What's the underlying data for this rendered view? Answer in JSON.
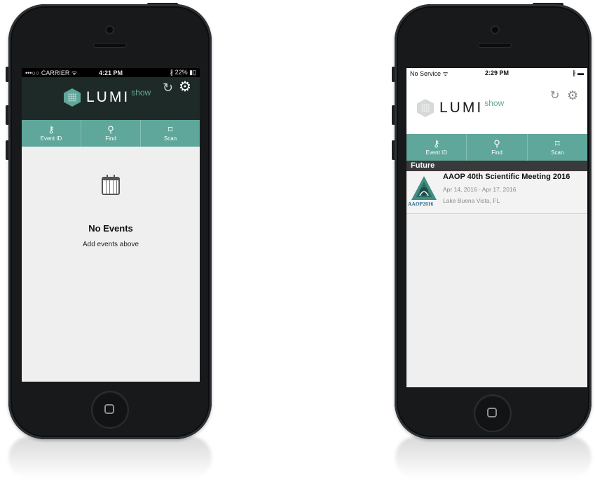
{
  "left_phone": {
    "status": {
      "left": "•••○○ CARRIER ᯤ",
      "time": "4:21 PM",
      "right": "∦ 22% ▮▯"
    },
    "header": {
      "logo_word": "LUMI",
      "logo_sub": "show",
      "refresh_icon": "refresh-icon",
      "settings_icon": "gear-icon"
    },
    "nav": [
      {
        "label": "Event ID",
        "icon": "key-icon",
        "glyph": "⚷"
      },
      {
        "label": "Find",
        "icon": "search-icon",
        "glyph": "⚲"
      },
      {
        "label": "Scan",
        "icon": "scan-icon",
        "glyph": "⌑"
      }
    ],
    "empty": {
      "title": "No Events",
      "subtitle": "Add events above",
      "icon": "calendar-icon"
    }
  },
  "right_phone": {
    "status": {
      "left": "No Service ᯤ",
      "time": "2:29 PM",
      "right": "∦ ▬"
    },
    "header": {
      "logo_word": "LUMI",
      "logo_sub": "show",
      "refresh_icon": "refresh-icon",
      "settings_icon": "gear-icon"
    },
    "nav": [
      {
        "label": "Event ID",
        "icon": "key-icon",
        "glyph": "⚷"
      },
      {
        "label": "Find",
        "icon": "search-icon",
        "glyph": "⚲"
      },
      {
        "label": "Scan",
        "icon": "scan-icon",
        "glyph": "⌑"
      }
    ],
    "section_label": "Future",
    "events": [
      {
        "title": "AAOP 40th Scientific Meeting 2016",
        "dates": "Apr 14, 2016 - Apr 17, 2016",
        "location": "Lake Buena Vista, FL",
        "logo_text": "AAOP2016"
      }
    ]
  },
  "colors": {
    "accent": "#5fa79a",
    "header_dark": "#1e2a28",
    "header_light": "#ffffff",
    "section_bar": "#3a3a3a"
  }
}
